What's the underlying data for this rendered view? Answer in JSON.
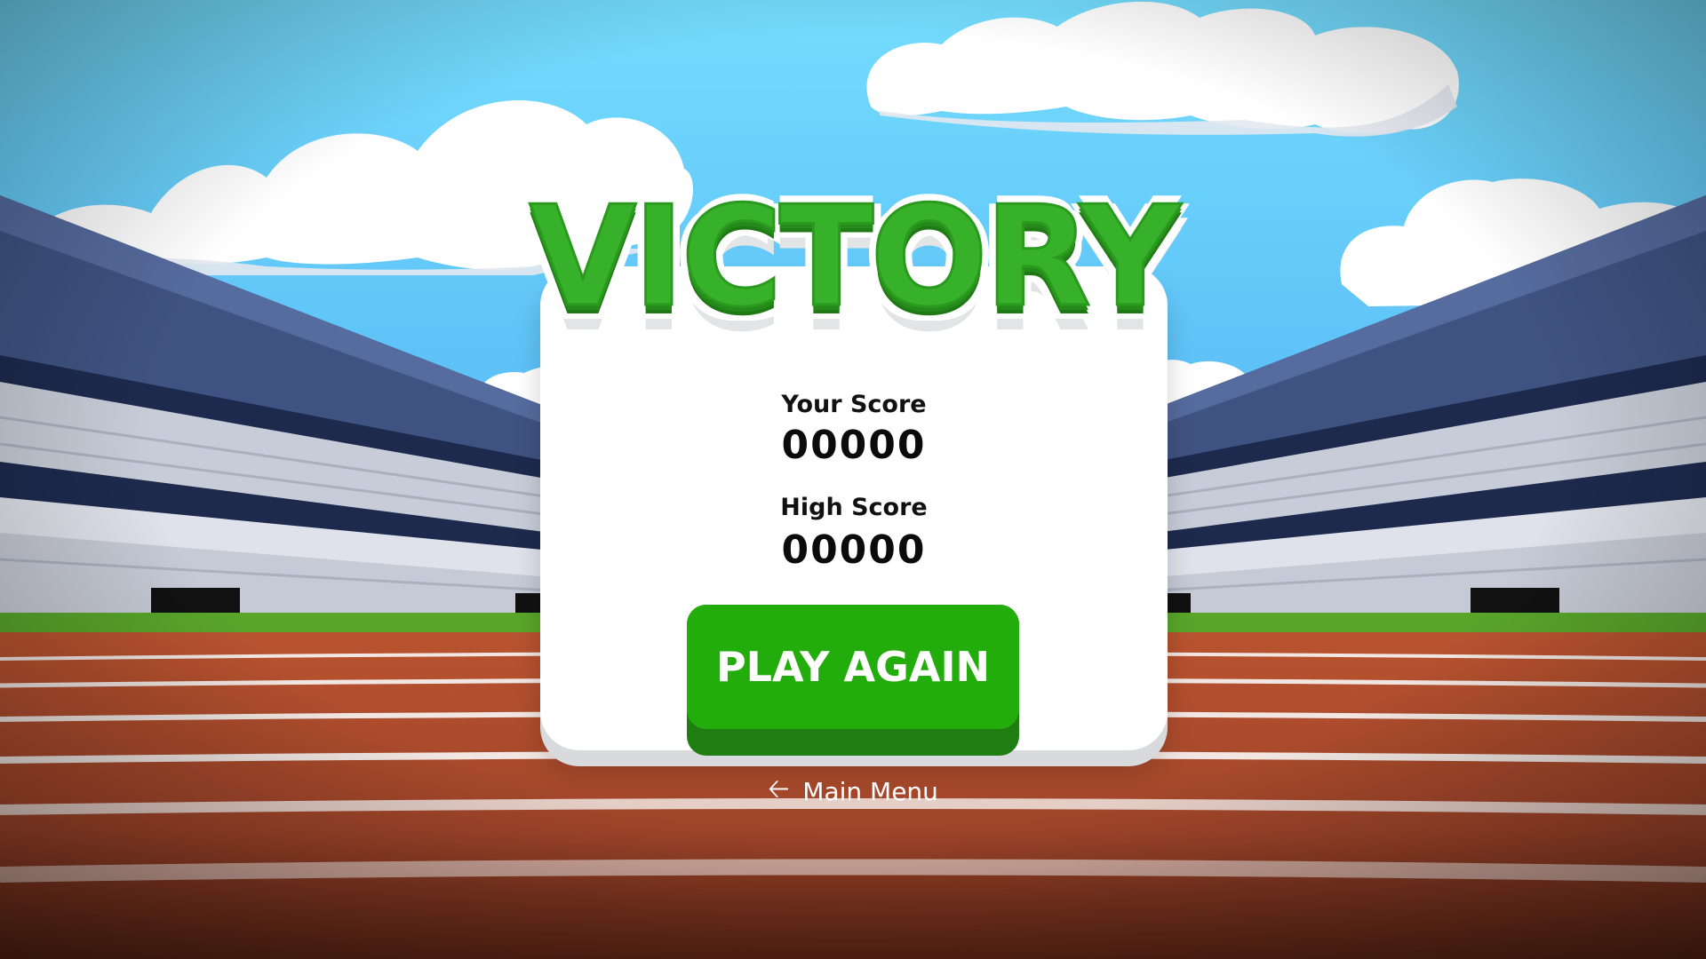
{
  "title": "VICTORY",
  "score": {
    "your_label": "Your Score",
    "your_value": "00000",
    "high_label": "High Score",
    "high_value": "00000"
  },
  "buttons": {
    "play_again": "PLAY AGAIN",
    "main_menu": "Main Menu",
    "main_menu_icon": "arrow-left-icon"
  },
  "colors": {
    "sky_top": "#6fd6fb",
    "sky_bottom": "#5ab2f0",
    "title_green": "#38b12a",
    "button_green": "#23ad0c",
    "button_shadow": "#1f7d12",
    "track": "#b14a2f",
    "grass": "#59a52a"
  }
}
